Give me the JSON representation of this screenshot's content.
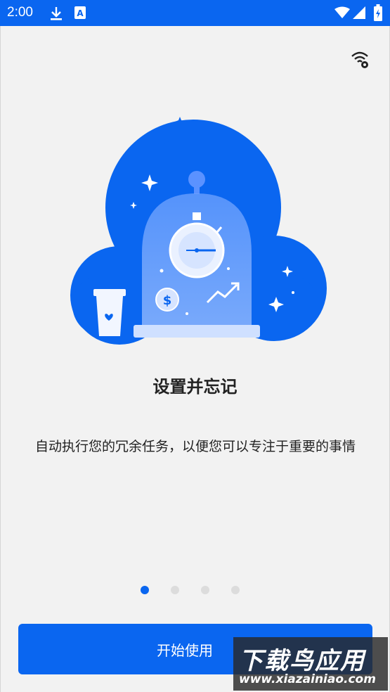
{
  "status_bar": {
    "time": "2:00",
    "icons": [
      "download-icon",
      "a-icon",
      "wifi-icon",
      "signal-icon",
      "battery-icon"
    ]
  },
  "top_icon": "wifi-settings-icon",
  "onboarding": {
    "title": "设置并忘记",
    "description": "自动执行您的冗余任务，以便您可以专注于重要的事情",
    "page_count": 4,
    "active_page": 1
  },
  "start_button": {
    "label": "开始使用"
  },
  "watermark": {
    "title": "下载鸟应用",
    "url": "www.xiazainiao.com"
  },
  "colors": {
    "accent": "#0a66f0",
    "background": "#f2f2f2",
    "text": "#222222"
  }
}
